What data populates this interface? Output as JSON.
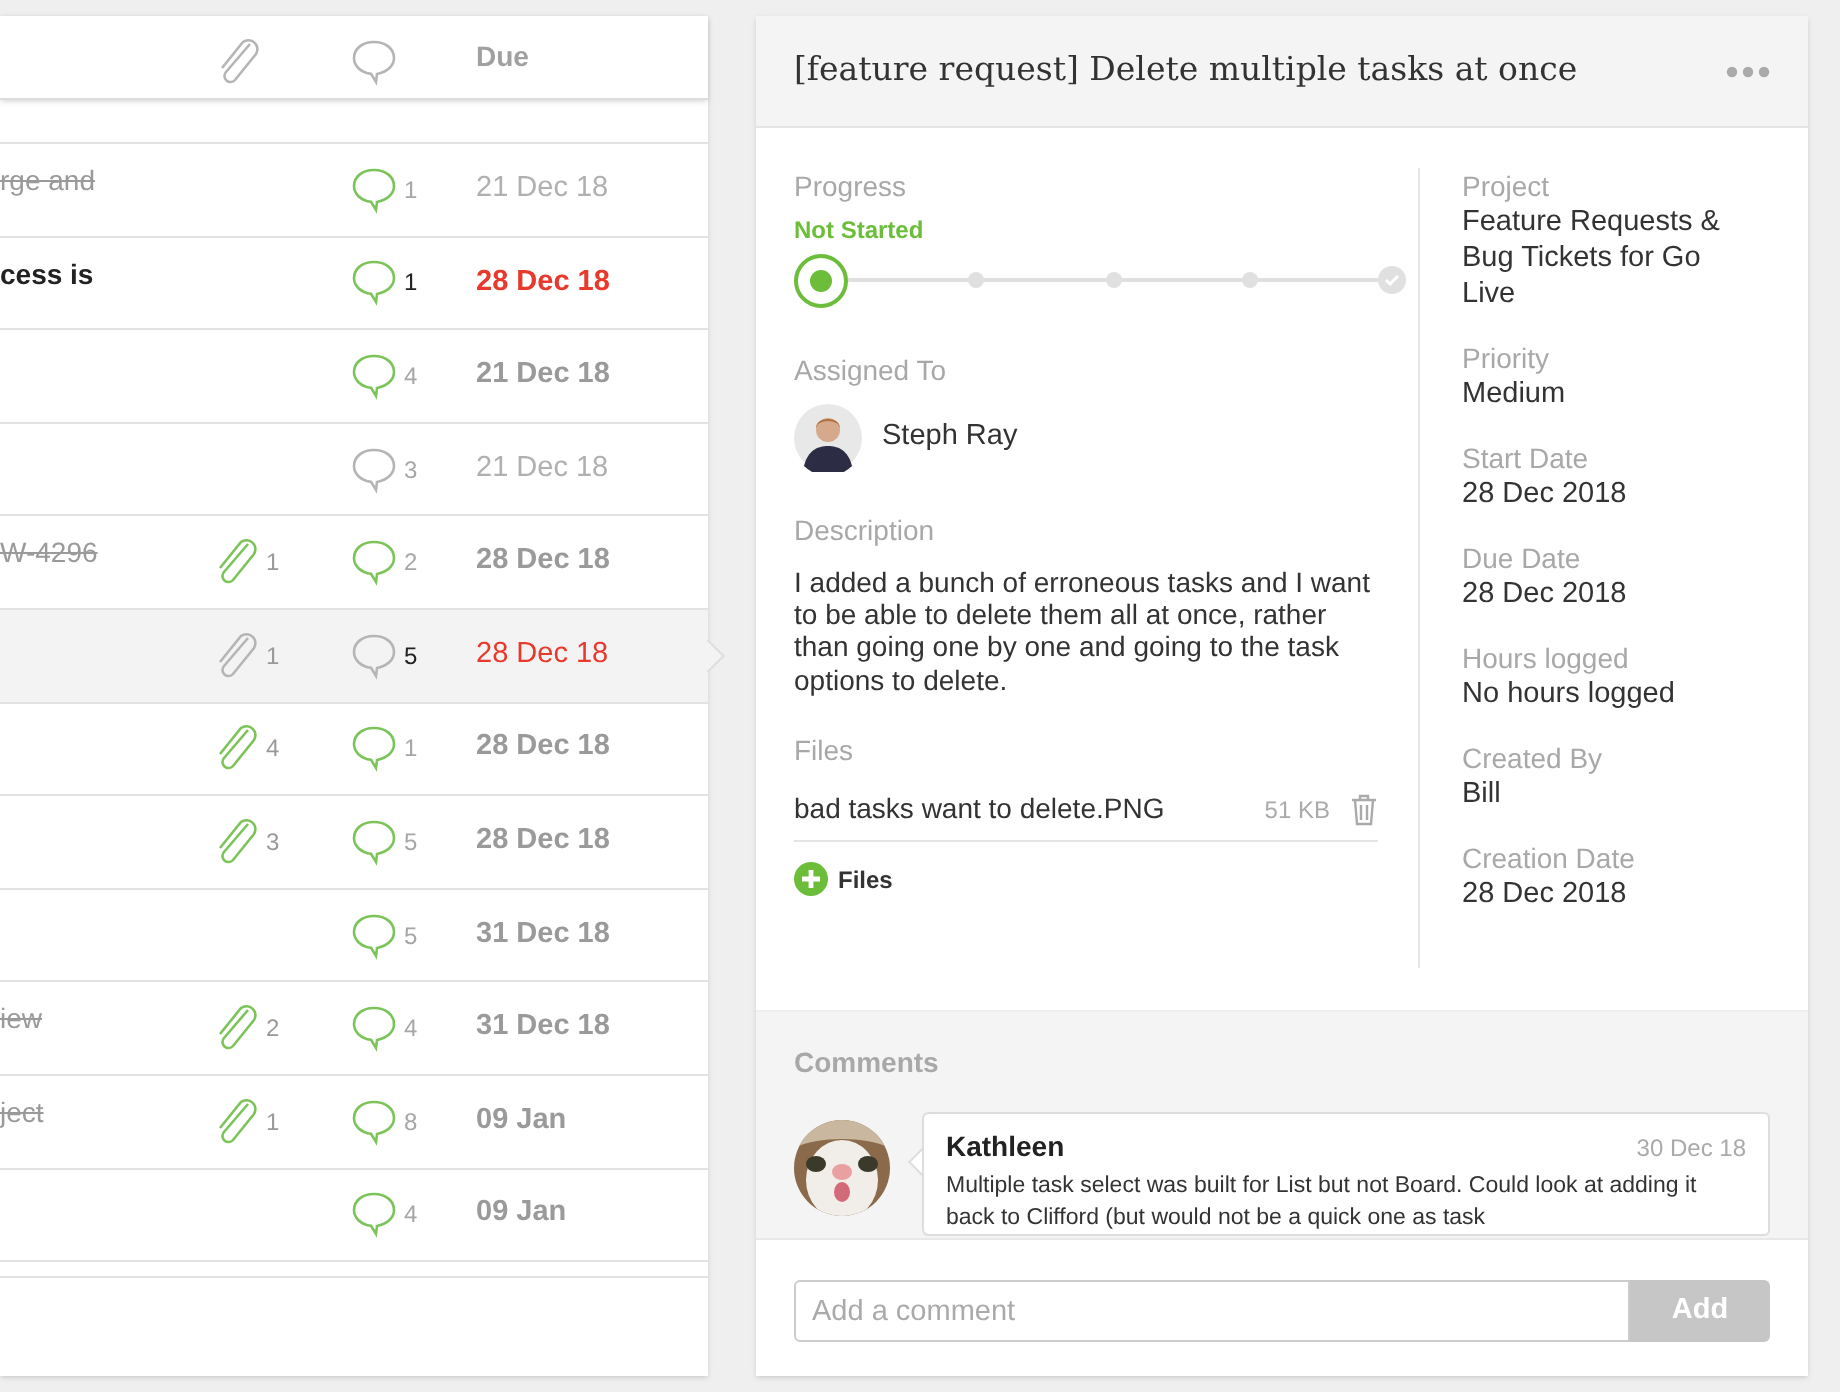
{
  "task_list": {
    "columns": {
      "due": "Due"
    },
    "rows": [
      {
        "title": "rge and",
        "done": true,
        "bold": false,
        "selected": false,
        "attachments": null,
        "comments": {
          "count": "1",
          "active": true,
          "unread": false
        },
        "due": {
          "text": "21 Dec 18",
          "overdue": false,
          "faded": true
        }
      },
      {
        "title": "cess is",
        "done": false,
        "bold": true,
        "selected": false,
        "attachments": null,
        "comments": {
          "count": "1",
          "active": true,
          "unread": true
        },
        "due": {
          "text": "28 Dec 18",
          "overdue": true,
          "faded": false
        }
      },
      {
        "selected": false,
        "attachments": null,
        "comments": {
          "count": "4",
          "active": true,
          "unread": false
        },
        "due": {
          "text": "21 Dec 18",
          "overdue": false,
          "faded": false
        }
      },
      {
        "selected": false,
        "attachments": null,
        "comments": {
          "count": "3",
          "active": false,
          "unread": false
        },
        "due": {
          "text": "21 Dec 18",
          "overdue": false,
          "faded": true
        }
      },
      {
        "title": "W-4296",
        "done": true,
        "bold": false,
        "selected": false,
        "attachments": {
          "count": "1",
          "active": true
        },
        "comments": {
          "count": "2",
          "active": true,
          "unread": false
        },
        "due": {
          "text": "28 Dec 18",
          "overdue": false,
          "faded": false
        }
      },
      {
        "selected": true,
        "attachments": {
          "count": "1",
          "active": false
        },
        "comments": {
          "count": "5",
          "active": false,
          "unread": true
        },
        "due": {
          "text": "28 Dec 18",
          "overdue": true,
          "faded": false
        }
      },
      {
        "selected": false,
        "attachments": {
          "count": "4",
          "active": true
        },
        "comments": {
          "count": "1",
          "active": true,
          "unread": false
        },
        "due": {
          "text": "28 Dec 18",
          "overdue": false,
          "faded": false
        }
      },
      {
        "selected": false,
        "attachments": {
          "count": "3",
          "active": true
        },
        "comments": {
          "count": "5",
          "active": true,
          "unread": false
        },
        "due": {
          "text": "28 Dec 18",
          "overdue": false,
          "faded": false
        }
      },
      {
        "selected": false,
        "attachments": null,
        "comments": {
          "count": "5",
          "active": true,
          "unread": false
        },
        "due": {
          "text": "31 Dec 18",
          "overdue": false,
          "faded": false
        }
      },
      {
        "title": "iew",
        "done": true,
        "bold": false,
        "selected": false,
        "attachments": {
          "count": "2",
          "active": true
        },
        "comments": {
          "count": "4",
          "active": true,
          "unread": false
        },
        "due": {
          "text": "31 Dec 18",
          "overdue": false,
          "faded": false
        }
      },
      {
        "title": "ject",
        "done": true,
        "bold": false,
        "selected": false,
        "attachments": {
          "count": "1",
          "active": true
        },
        "comments": {
          "count": "8",
          "active": true,
          "unread": false
        },
        "due": {
          "text": "09 Jan",
          "overdue": false,
          "faded": false
        }
      },
      {
        "selected": false,
        "attachments": null,
        "comments": {
          "count": "4",
          "active": true,
          "unread": false
        },
        "due": {
          "text": "09 Jan",
          "overdue": false,
          "faded": false
        }
      }
    ]
  },
  "task": {
    "title": "[feature request] Delete multiple tasks at once",
    "progress": {
      "label": "Progress",
      "status": "Not Started",
      "steps": [
        {
          "kind": "step",
          "selected": true
        },
        {
          "kind": "step",
          "selected": false
        },
        {
          "kind": "step",
          "selected": false
        },
        {
          "kind": "step",
          "selected": false
        },
        {
          "kind": "done",
          "selected": false
        }
      ]
    },
    "assigned": {
      "label": "Assigned To",
      "name": "Steph Ray"
    },
    "description": {
      "label": "Description",
      "text": "I added a bunch of erroneous tasks and I want to be able to delete them all at once, rather than going one by one and going to the task options to delete."
    },
    "files": {
      "label": "Files",
      "items": [
        {
          "name": "bad tasks want to delete.PNG",
          "size": "51 KB"
        }
      ],
      "add_label": "Files"
    },
    "details": [
      {
        "label": "Project",
        "value": "Feature Requests & Bug Tickets for Go Live"
      },
      {
        "label": "Priority",
        "value": "Medium"
      },
      {
        "label": "Start Date",
        "value": "28 Dec 2018"
      },
      {
        "label": "Due Date",
        "value": "28 Dec 2018"
      },
      {
        "label": "Hours logged",
        "value": "No hours logged"
      },
      {
        "label": "Created By",
        "value": "Bill"
      },
      {
        "label": "Creation Date",
        "value": "28 Dec 2018"
      }
    ]
  },
  "comments": {
    "label": "Comments",
    "items": [
      {
        "author": "Kathleen",
        "date": "30 Dec 18",
        "text": "Multiple task select was built for List but not Board. Could look at adding it back to Clifford (but would not be a quick one as task"
      }
    ],
    "input": {
      "placeholder": "Add a comment"
    },
    "add_button": "Add"
  }
}
